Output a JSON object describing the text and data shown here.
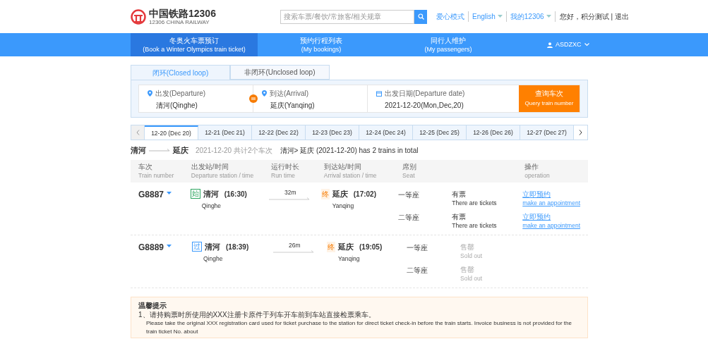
{
  "header": {
    "logo_title": "中国铁路12306",
    "logo_subtitle": "12306 CHINA RAILWAY",
    "search": {
      "placeholder": "搜索车票/餐饮/常旅客/相关规章"
    },
    "links": [
      {
        "label": "爱心模式",
        "dropdown": false
      },
      {
        "label": "English",
        "dropdown": true
      },
      {
        "label": "我的12306",
        "dropdown": true
      }
    ],
    "greeting": "您好，积分测试 | 退出"
  },
  "nav": {
    "items": [
      {
        "label": "冬奥火车票预订",
        "sublabel": "(Book a Winter Olympics train ticket)",
        "selected": true
      },
      {
        "label": "预约行程列表",
        "sublabel": "(My bookings)",
        "selected": false
      },
      {
        "label": "同行人维护",
        "sublabel": "(My passengers)",
        "selected": false
      }
    ],
    "user": "ASDZXC"
  },
  "loop_tabs": [
    {
      "label": "闭环(Closed loop)",
      "selected": true
    },
    {
      "label": "非闭环(Unclosed loop)",
      "selected": false
    }
  ],
  "query": {
    "departure": {
      "label": "出发(Departure)",
      "value": "清河(Qinghe)"
    },
    "arrival": {
      "label": "到达(Arrival)",
      "value": "延庆(Yanqing)"
    },
    "date": {
      "label": "出发日期(Departure date)",
      "value": "2021-12-20(Mon,Dec,20)"
    },
    "button": {
      "label": "查询车次",
      "sublabel": "Query train number"
    }
  },
  "date_tabs": [
    {
      "label": "12-20 (Dec 20)",
      "selected": true
    },
    {
      "label": "12-21 (Dec 21)",
      "selected": false
    },
    {
      "label": "12-22 (Dec 22)",
      "selected": false
    },
    {
      "label": "12-23 (Dec 23)",
      "selected": false
    },
    {
      "label": "12-24 (Dec 24)",
      "selected": false
    },
    {
      "label": "12-25 (Dec 25)",
      "selected": false
    },
    {
      "label": "12-26 (Dec 26)",
      "selected": false
    },
    {
      "label": "12-27 (Dec 27)",
      "selected": false
    }
  ],
  "route": {
    "from": "清河",
    "to": "延庆",
    "summary_cn": "2021-12-20 共计2个车次",
    "summary_en": "清河> 延庆 (2021-12-20) has 2 trains in total"
  },
  "columns": [
    {
      "cn": "车次",
      "en": "Train number"
    },
    {
      "cn": "出发站/时间",
      "en": "Departure station / time"
    },
    {
      "cn": "运行时长",
      "en": "Run time"
    },
    {
      "cn": "到达站/时间",
      "en": "Arrival station / time"
    },
    {
      "cn": "席别",
      "en": "Seat"
    },
    {
      "cn": "操作",
      "en": "operation"
    }
  ],
  "trains": [
    {
      "number": "G8887",
      "dep_badge": {
        "label": "始",
        "color": "#2ca55f"
      },
      "dep_station": "清河",
      "dep_time": "(16:30)",
      "dep_en": "Qinghe",
      "run_time": "32m",
      "arr_badge": "终",
      "arr_station": "延庆",
      "arr_time": "(17:02)",
      "arr_en": "Yanqing",
      "seats": [
        {
          "name": "一等座",
          "available": true,
          "status": "有票",
          "status_en": "There are tickets",
          "action": "立即预约",
          "action_en": "make an appointment"
        },
        {
          "name": "二等座",
          "available": true,
          "status": "有票",
          "status_en": "There are tickets",
          "action": "立即预约",
          "action_en": "make an appointment"
        }
      ]
    },
    {
      "number": "G8889",
      "dep_badge": {
        "label": "过",
        "color": "#3b99fc"
      },
      "dep_station": "清河",
      "dep_time": "(18:39)",
      "dep_en": "Qinghe",
      "run_time": "26m",
      "arr_badge": "终",
      "arr_station": "延庆",
      "arr_time": "(19:05)",
      "arr_en": "Yanqing",
      "seats": [
        {
          "name": "一等座",
          "available": false,
          "status": "售罄",
          "status_en": "Sold out"
        },
        {
          "name": "二等座",
          "available": false,
          "status": "售罄",
          "status_en": "Sold out"
        }
      ]
    }
  ],
  "notice": {
    "title": "温馨提示",
    "items": [
      {
        "cn": "1、请持购票时所使用的XXX注册卡原件于列车开车前到车站直接检票乘车。",
        "en": "Please take the original XXX registration card used for ticket purchase to the station for direct ticket check-in before the train starts. Invoice business is not provided for the train ticket No. about"
      }
    ]
  }
}
